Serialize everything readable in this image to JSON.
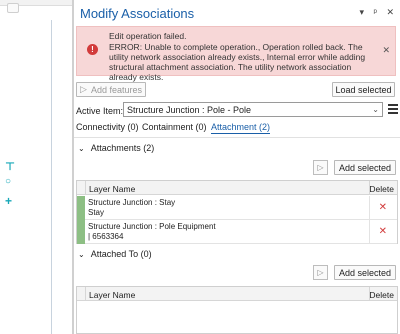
{
  "window": {
    "title": "Modify Associations",
    "controls": {
      "options": "▾",
      "pin": "ᵖ",
      "close": "✕"
    }
  },
  "error": {
    "title": "Edit operation failed.",
    "message": "ERROR: Unable to complete operation., Operation rolled back. The utility network association already exists., Internal error while adding structural attachment association. The utility network association already exists.",
    "close": "✕",
    "color": "#f7d7d7"
  },
  "toolbar": {
    "add_features": "Add features",
    "load_selected": "Load selected"
  },
  "active_item": {
    "label": "Active Item:",
    "value": "Structure Junction : Pole - Pole"
  },
  "tabs": [
    {
      "label": "Connectivity (0)"
    },
    {
      "label": "Containment (0)"
    },
    {
      "label": "Attachment (2)"
    }
  ],
  "attachments": {
    "header": "Attachments (2)",
    "add_selected": "Add selected",
    "columns": {
      "layer": "Layer Name",
      "delete": "Delete"
    },
    "rows": [
      {
        "line1": "Structure Junction : Stay",
        "line2": "Stay"
      },
      {
        "line1": "Structure Junction : Pole Equipment",
        "line2": "| 6563364"
      }
    ]
  },
  "attached_to": {
    "header": "Attached To (0)",
    "add_selected": "Add selected",
    "columns": {
      "layer": "Layer Name",
      "delete": "Delete"
    }
  },
  "icons": {
    "chevron": "⌄",
    "play": "▷",
    "delete": "✕",
    "error": "!",
    "map_pole": "⊤",
    "map_circle": "○",
    "map_plus": "+"
  },
  "colors": {
    "accent": "#1a5fa8",
    "error": "#d23b3b",
    "row_marker": "#8dbf84"
  }
}
